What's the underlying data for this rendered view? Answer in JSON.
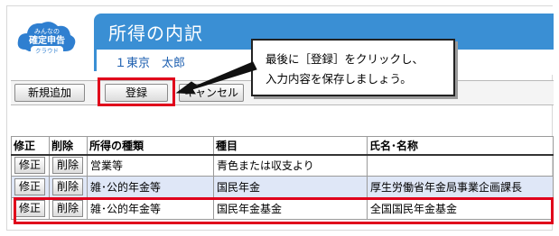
{
  "app": {
    "logo_line1": "みんなの",
    "logo_line2": "確定申告",
    "logo_line3": "クラウド"
  },
  "header": {
    "title": "所得の内訳",
    "user": "１東京　太郎"
  },
  "toolbar": {
    "new_label": "新規追加",
    "save_label": "登録",
    "cancel_label": "キャンセル"
  },
  "callout": {
    "line1": "最後に［登録］をクリックし、",
    "line2": "入力内容を保存しましょう。"
  },
  "table": {
    "headers": [
      "修正",
      "削除",
      "所得の種類",
      "種目",
      "氏名･名称"
    ],
    "edit_label": "修正",
    "delete_label": "削除",
    "rows": [
      {
        "type": "営業等",
        "item": "青色または収支より",
        "name": ""
      },
      {
        "type": "雑･公的年金等",
        "item": "国民年金",
        "name": "厚生労働省年金局事業企画課長"
      },
      {
        "type": "雑･公的年金等",
        "item": "国民年金基金",
        "name": "全国国民年金基金"
      }
    ]
  },
  "colors": {
    "header_blue": "#3a8fd4",
    "highlight_red": "#e0001b",
    "alt_row": "#dfe7f7"
  }
}
